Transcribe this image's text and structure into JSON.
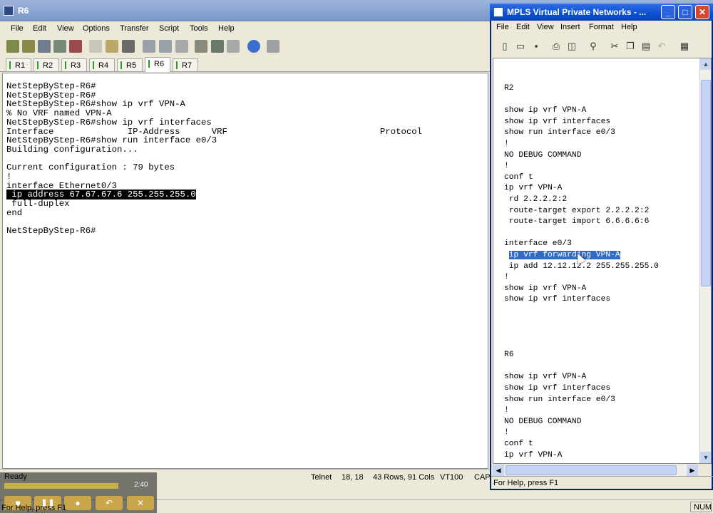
{
  "crt": {
    "title": "R6",
    "menu": [
      "File",
      "Edit",
      "View",
      "Options",
      "Transfer",
      "Script",
      "Tools",
      "Help"
    ],
    "tabs": [
      "R1",
      "R2",
      "R3",
      "R4",
      "R5",
      "R6",
      "R7"
    ],
    "active_tab": "R6",
    "terminal": {
      "lines_before": "NetStepByStep-R6#\nNetStepByStep-R6#\nNetStepByStep-R6#show ip vrf VPN-A\n% No VRF named VPN-A\nNetStepByStep-R6#show ip vrf interfaces\nInterface              IP-Address      VRF                             Protocol\nNetStepByStep-R6#show run interface e0/3\nBuilding configuration...\n\nCurrent configuration : 79 bytes\n!\ninterface Ethernet0/3\n",
      "highlighted": " ip address 67.67.67.6 255.255.255.0",
      "lines_after": "\n full-duplex\nend\n\nNetStepByStep-R6#"
    },
    "status": {
      "ready": "Ready",
      "protocol": "Telnet",
      "position": "18, 18",
      "size": "43 Rows, 91 Cols",
      "emulation": "VT100",
      "caps": "CAP",
      "help": "For Help, press F1",
      "num": "NUM"
    }
  },
  "player": {
    "time": "2:40"
  },
  "mpls": {
    "title": "MPLS Virtual Private Networks - ...",
    "menu": [
      "File",
      "Edit",
      "View",
      "Insert",
      "Format",
      "Help"
    ],
    "doc_before": "R2\n\nshow ip vrf VPN-A\nshow ip vrf interfaces\nshow run interface e0/3\n!\nNO DEBUG COMMAND\n!\nconf t\nip vrf VPN-A\n rd 2.2.2.2:2\n route-target export 2.2.2.2:2\n route-target import 6.6.6.6:6\n\ninterface e0/3\n",
    "doc_selected": "ip vrf forwarding VPN-A",
    "doc_after": "\n ip add 12.12.12.2 255.255.255.0\n!\nshow ip vrf VPN-A\nshow ip vrf interfaces\n\n\n\n\nR6\n\nshow ip vrf VPN-A\nshow ip vrf interfaces\nshow run interface e0/3\n!\nNO DEBUG COMMAND\n!\nconf t\nip vrf VPN-A",
    "status": "For Help, press F1"
  }
}
